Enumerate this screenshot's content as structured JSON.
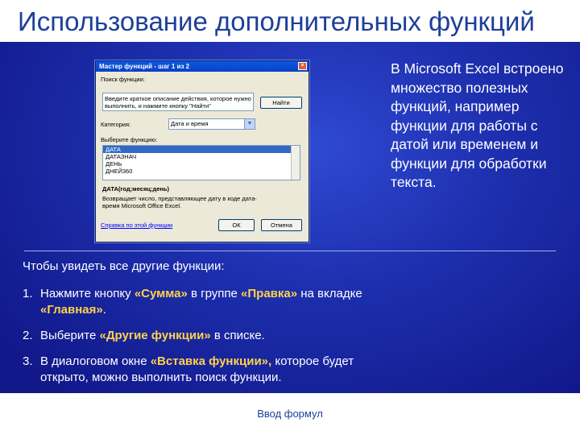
{
  "slide": {
    "title": "Использование дополнительных функций",
    "footer": "Ввод формул",
    "side_text": "В Microsoft Excel встроено множество полезных функций, например функции для работы с датой или временем и функции для обработки текста.",
    "intro": "Чтобы увидеть все другие функции:",
    "steps": [
      {
        "num": "1.",
        "a": "Нажмите кнопку ",
        "b": "«Сумма»",
        "c": " в группе ",
        "d": "«Правка»",
        "e": " на вкладке ",
        "f": "«Главная»",
        "g": "."
      },
      {
        "num": "2.",
        "a": "Выберите ",
        "b": "«Другие функции»",
        "c": " в списке."
      },
      {
        "num": "3.",
        "a": "В диалоговом окне ",
        "b": "«Вставка функции»,",
        "c": " которое будет открыто, можно выполнить поиск функции."
      }
    ]
  },
  "dialog": {
    "title": "Мастер функций - шаг 1 из 2",
    "close": "×",
    "search_label": "Поиск функции:",
    "search_text": "Введите краткое описание действия, которое нужно выполнить, и нажмите кнопку \"Найти\"",
    "find_button": "Найти",
    "category_label": "Категория:",
    "category_value": "Дата и время",
    "select_label": "Выберите функцию:",
    "functions": [
      "ДАТА",
      "ДАТАЗНАЧ",
      "ДЕНЬ",
      "ДНЕЙ360"
    ],
    "selected_fn": "ДАТА(год;месяц;день)",
    "description": "Возвращает число, представляющее дату в коде дата-время Microsoft Office Excel.",
    "help_link": "Справка по этой функции",
    "ok": "ОК",
    "cancel": "Отмена"
  }
}
